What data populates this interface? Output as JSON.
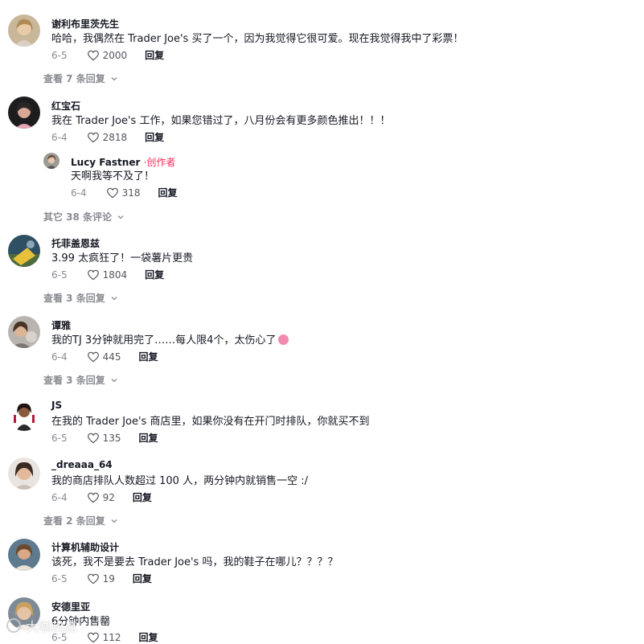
{
  "comments": [
    {
      "user": "谢利布里茨先生",
      "text": "哈哈，我偶然在 Trader Joe's 买了一个，因为我觉得它很可爱。现在我觉得我中了彩票！",
      "date": "6-5",
      "likes": "2000",
      "reply_label": "回复",
      "more_label": "查看 7 条回复"
    },
    {
      "user": "红宝石",
      "text": "我在 Trader Joe's 工作，如果您错过了，八月份会有更多颜色推出！！！",
      "date": "6-4",
      "likes": "2818",
      "reply_label": "回复",
      "reply": {
        "user": "Lucy Fastner",
        "badge": "·创作者",
        "text": "天啊我等不及了！",
        "date": "6-4",
        "likes": "318",
        "reply_label": "回复"
      },
      "more_label": "其它 38 条评论"
    },
    {
      "user": "托菲盖恩兹",
      "text": "3.99 太疯狂了！一袋薯片更贵",
      "date": "6-5",
      "likes": "1804",
      "reply_label": "回复",
      "more_label": "查看 3 条回复"
    },
    {
      "user": "谭雅",
      "text": "我的TJ 3分钟就用完了……每人限4个，太伤心了",
      "date": "6-4",
      "likes": "445",
      "reply_label": "回复",
      "more_label": "查看 3 条回复"
    },
    {
      "user": "JS",
      "text": "在我的 Trader Joe's 商店里，如果你没有在开门时排队，你就买不到",
      "date": "6-5",
      "likes": "135",
      "reply_label": "回复"
    },
    {
      "user": "_dreaaa_64",
      "text": "我的商店排队人数超过 100 人，两分钟内就销售一空 :/",
      "date": "6-4",
      "likes": "92",
      "reply_label": "回复",
      "more_label": "查看 2 条回复"
    },
    {
      "user": "计算机辅助设计",
      "text": "该死，我不是要去 Trader Joe's 吗，我的鞋子在哪儿？？？？",
      "date": "6-5",
      "likes": "19",
      "reply_label": "回复"
    },
    {
      "user": "安德里亚",
      "text": "6分钟内售罄",
      "date": "6-5",
      "likes": "112",
      "reply_label": "回复"
    }
  ],
  "watermark": "大咖热点",
  "colors": {
    "creator": "#fe2c55",
    "muted": "#8a8b91",
    "text": "#161823"
  }
}
